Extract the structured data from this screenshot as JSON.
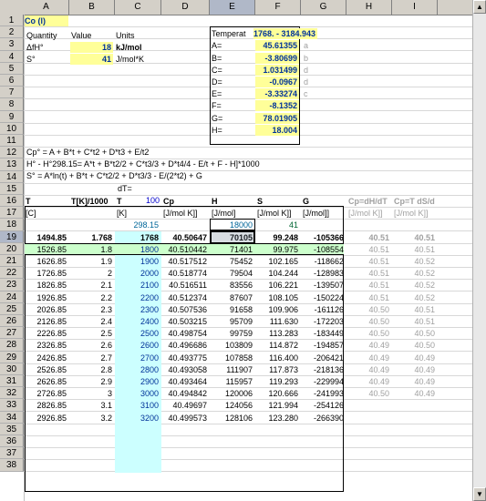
{
  "columns": [
    "A",
    "B",
    "C",
    "D",
    "E",
    "F",
    "G",
    "H",
    "I"
  ],
  "rows": [
    "1",
    "2",
    "3",
    "4",
    "5",
    "6",
    "7",
    "8",
    "9",
    "10",
    "11",
    "12",
    "13",
    "14",
    "15",
    "16",
    "17",
    "18",
    "19",
    "20",
    "21",
    "22",
    "23",
    "24",
    "25",
    "26",
    "27",
    "28",
    "29",
    "30",
    "31",
    "32",
    "33",
    "34",
    "35",
    "36",
    "37",
    "38"
  ],
  "selected_column": "E",
  "selected_row": "19",
  "compound": "Co (l)",
  "props": {
    "hdr_quantity": "Quantity",
    "hdr_value": "Value",
    "hdr_units": "Units",
    "dh_label": "ΔfH°",
    "dh_value": "18",
    "dh_units": "kJ/mol",
    "s_label": "S°",
    "s_value": "41",
    "s_units": "J/mol*K"
  },
  "coeffs": {
    "temp_label": "Temperat",
    "temp_range": "1768. - 3184.943",
    "rows": [
      {
        "name": "A=",
        "value": "45.61355",
        "tag": "a"
      },
      {
        "name": "B=",
        "value": "-3.80699",
        "tag": "b"
      },
      {
        "name": "C=",
        "value": "1.031499",
        "tag": "d"
      },
      {
        "name": "D=",
        "value": "-0.0967",
        "tag": "d"
      },
      {
        "name": "E=",
        "value": "-3.33274",
        "tag": "c"
      },
      {
        "name": "F=",
        "value": "-8.1352",
        "tag": ""
      },
      {
        "name": "G=",
        "value": "78.01905",
        "tag": ""
      },
      {
        "name": "H=",
        "value": "18.004",
        "tag": ""
      }
    ]
  },
  "formulas": {
    "f1": "Cp° = A + B*t + C*t2 + D*t3 + E/t2",
    "f2": "H° - H°298.15= A*t + B*t2/2 + C*t3/3 + D*t4/4 - E/t + F - H]*1000",
    "f3": "S° = A*ln(t) + B*t + C*t2/2 + D*t3/3 - E/(2*t2) + G",
    "dt_label": "dT=",
    "dt_value": "100"
  },
  "table": {
    "headers": [
      "T",
      "T[K]/1000",
      "T",
      "Cp",
      "H",
      "S",
      "G",
      "Cp=dH/dT",
      "Cp=T dS/dT"
    ],
    "units": [
      "[C]",
      "",
      "[K]",
      "[J/mol K]]",
      "[J/mol]",
      "[J/mol K]]",
      "[J/mol]]",
      "[J/mol K]]",
      "[J/mol K]]"
    ],
    "ref_row": [
      "",
      "",
      "298.15",
      "",
      "18000",
      "41",
      "",
      "",
      ""
    ],
    "highlight_row": [
      "1494.85",
      "1.768",
      "1768",
      "40.50647",
      "70105",
      "99.248",
      "-105366",
      "40.51",
      "40.51"
    ],
    "data": [
      [
        "1526.85",
        "1.8",
        "1800",
        "40.510442",
        "71401",
        "99.975",
        "-108554",
        "40.51",
        "40.51"
      ],
      [
        "1626.85",
        "1.9",
        "1900",
        "40.517512",
        "75452",
        "102.165",
        "-118662",
        "40.51",
        "40.52"
      ],
      [
        "1726.85",
        "2",
        "2000",
        "40.518774",
        "79504",
        "104.244",
        "-128983",
        "40.51",
        "40.52"
      ],
      [
        "1826.85",
        "2.1",
        "2100",
        "40.516511",
        "83556",
        "106.221",
        "-139507",
        "40.51",
        "40.52"
      ],
      [
        "1926.85",
        "2.2",
        "2200",
        "40.512374",
        "87607",
        "108.105",
        "-150224",
        "40.51",
        "40.52"
      ],
      [
        "2026.85",
        "2.3",
        "2300",
        "40.507536",
        "91658",
        "109.906",
        "-161126",
        "40.50",
        "40.51"
      ],
      [
        "2126.85",
        "2.4",
        "2400",
        "40.503215",
        "95709",
        "111.630",
        "-172203",
        "40.50",
        "40.51"
      ],
      [
        "2226.85",
        "2.5",
        "2500",
        "40.498754",
        "99759",
        "113.283",
        "-183449",
        "40.50",
        "40.50"
      ],
      [
        "2326.85",
        "2.6",
        "2600",
        "40.496686",
        "103809",
        "114.872",
        "-194857",
        "40.49",
        "40.50"
      ],
      [
        "2426.85",
        "2.7",
        "2700",
        "40.493775",
        "107858",
        "116.400",
        "-206421",
        "40.49",
        "40.49"
      ],
      [
        "2526.85",
        "2.8",
        "2800",
        "40.493058",
        "111907",
        "117.873",
        "-218136",
        "40.49",
        "40.49"
      ],
      [
        "2626.85",
        "2.9",
        "2900",
        "40.493464",
        "115957",
        "119.293",
        "-229994",
        "40.49",
        "40.49"
      ],
      [
        "2726.85",
        "3",
        "3000",
        "40.494842",
        "120006",
        "120.666",
        "-241993",
        "40.50",
        "40.49"
      ],
      [
        "2826.85",
        "3.1",
        "3100",
        "40.49697",
        "124056",
        "121.994",
        "-254126",
        "",
        ""
      ],
      [
        "2926.85",
        "3.2",
        "3200",
        "40.499573",
        "128106",
        "123.280",
        "-266390",
        "",
        ""
      ]
    ]
  }
}
